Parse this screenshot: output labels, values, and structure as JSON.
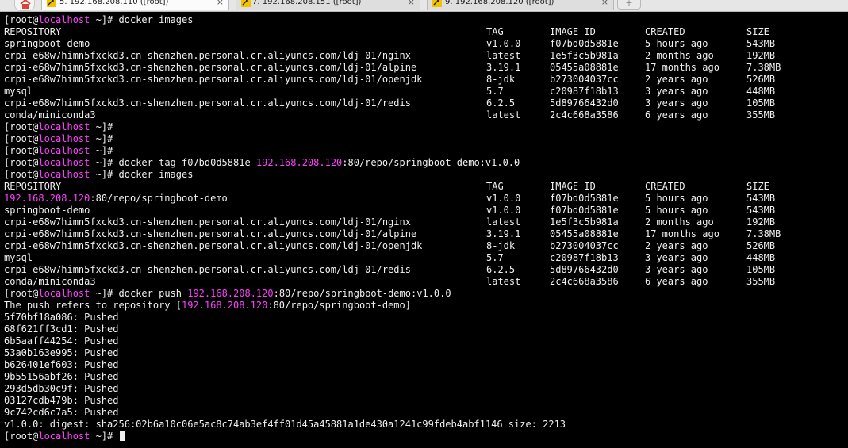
{
  "tabs": [
    {
      "label": "5. 192.168.208.110 ([root])",
      "active": true,
      "close": "×"
    },
    {
      "label": "7. 192.168.208.151 ([root])",
      "active": false,
      "close": "×"
    },
    {
      "label": "9. 192.168.208.120 ([root])",
      "active": false,
      "close": "×"
    }
  ],
  "tab_add": "+",
  "prompt": {
    "open": "[root@",
    "host": "localhost",
    "close": " ~]# "
  },
  "terminal": {
    "cmd1": "docker images",
    "headers": {
      "repo": "REPOSITORY",
      "tag": "TAG",
      "id": "IMAGE ID",
      "created": "CREATED",
      "size": "SIZE"
    },
    "table1": [
      {
        "repo": "springboot-demo",
        "tag": "v1.0.0",
        "id": "f07bd0d5881e",
        "created": "5 hours ago",
        "size": "543MB"
      },
      {
        "repo": "crpi-e68w7himn5fxckd3.cn-shenzhen.personal.cr.aliyuncs.com/ldj-01/nginx",
        "tag": "latest",
        "id": "1e5f3c5b981a",
        "created": "2 months ago",
        "size": "192MB"
      },
      {
        "repo": "crpi-e68w7himn5fxckd3.cn-shenzhen.personal.cr.aliyuncs.com/ldj-01/alpine",
        "tag": "3.19.1",
        "id": "05455a08881e",
        "created": "17 months ago",
        "size": "7.38MB"
      },
      {
        "repo": "crpi-e68w7himn5fxckd3.cn-shenzhen.personal.cr.aliyuncs.com/ldj-01/openjdk",
        "tag": "8-jdk",
        "id": "b273004037cc",
        "created": "2 years ago",
        "size": "526MB"
      },
      {
        "repo": "mysql",
        "tag": "5.7",
        "id": "c20987f18b13",
        "created": "3 years ago",
        "size": "448MB"
      },
      {
        "repo": "crpi-e68w7himn5fxckd3.cn-shenzhen.personal.cr.aliyuncs.com/ldj-01/redis",
        "tag": "6.2.5",
        "id": "5d89766432d0",
        "created": "3 years ago",
        "size": "105MB"
      },
      {
        "repo": "conda/miniconda3",
        "tag": "latest",
        "id": "2c4c668a3586",
        "created": "6 years ago",
        "size": "355MB"
      }
    ],
    "cmd_tag_pre": "docker tag f07bd0d5881e ",
    "registry_ip": "192.168.208.120",
    "cmd_tag_post": ":80/repo/springboot-demo:v1.0.0",
    "cmd2": "docker images",
    "table2_first": {
      "repo_ip": "192.168.208.120",
      "repo_rest": ":80/repo/springboot-demo",
      "tag": "v1.0.0",
      "id": "f07bd0d5881e",
      "created": "5 hours ago",
      "size": "543MB"
    },
    "table2": [
      {
        "repo": "springboot-demo",
        "tag": "v1.0.0",
        "id": "f07bd0d5881e",
        "created": "5 hours ago",
        "size": "543MB"
      },
      {
        "repo": "crpi-e68w7himn5fxckd3.cn-shenzhen.personal.cr.aliyuncs.com/ldj-01/nginx",
        "tag": "latest",
        "id": "1e5f3c5b981a",
        "created": "2 months ago",
        "size": "192MB"
      },
      {
        "repo": "crpi-e68w7himn5fxckd3.cn-shenzhen.personal.cr.aliyuncs.com/ldj-01/alpine",
        "tag": "3.19.1",
        "id": "05455a08881e",
        "created": "17 months ago",
        "size": "7.38MB"
      },
      {
        "repo": "crpi-e68w7himn5fxckd3.cn-shenzhen.personal.cr.aliyuncs.com/ldj-01/openjdk",
        "tag": "8-jdk",
        "id": "b273004037cc",
        "created": "2 years ago",
        "size": "526MB"
      },
      {
        "repo": "mysql",
        "tag": "5.7",
        "id": "c20987f18b13",
        "created": "3 years ago",
        "size": "448MB"
      },
      {
        "repo": "crpi-e68w7himn5fxckd3.cn-shenzhen.personal.cr.aliyuncs.com/ldj-01/redis",
        "tag": "6.2.5",
        "id": "5d89766432d0",
        "created": "3 years ago",
        "size": "105MB"
      },
      {
        "repo": "conda/miniconda3",
        "tag": "latest",
        "id": "2c4c668a3586",
        "created": "6 years ago",
        "size": "355MB"
      }
    ],
    "cmd_push_pre": "docker push ",
    "cmd_push_post": ":80/repo/springboot-demo:v1.0.0",
    "push_refers_pre": "The push refers to repository [",
    "push_refers_post": ":80/repo/springboot-demo]",
    "layers": [
      "5f70bf18a086: Pushed",
      "68f621ff3cd1: Pushed",
      "6b5aaff44254: Pushed",
      "53a0b163e995: Pushed",
      "b626401ef603: Pushed",
      "9b55156abf26: Pushed",
      "293d5db30c9f: Pushed",
      "03127cdb479b: Pushed",
      "9c742cd6c7a5: Pushed"
    ],
    "digest_line": "v1.0.0: digest: sha256:02b6a10c06e5ac8c74ab3ef4ff01d45a45881a1de430a1241c99fdeb4abf1146 size: 2213"
  }
}
